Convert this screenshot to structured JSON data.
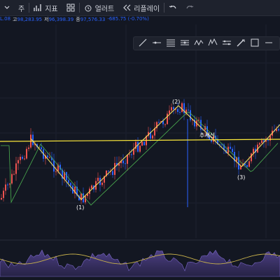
{
  "toolbar": {
    "interval_label": "주",
    "indicators_label": "지표",
    "alert_label": "얼러트",
    "replay_label": "리플레이"
  },
  "legend": {
    "open_value": "L.08",
    "high_label": "고",
    "high_value": "98,283.95",
    "low_label": "저",
    "low_value": "96,398.39",
    "close_label": "종",
    "close_value": "97,576.33",
    "change_value": "-685.75 (-0.70%)"
  },
  "chart_labels": {
    "wave_1": "(1)",
    "wave_2": "(2)",
    "wave_3": "(3)",
    "annotation": "추세선"
  },
  "colors": {
    "background": "#131722",
    "bull_candle": "#ef5350",
    "bear_candle": "#2962ff",
    "trend_line": "#ffeb3b",
    "moving_average": "#4caf50",
    "oscillator_line": "#c9b24b",
    "oscillator_fill": "#5b4a9a"
  },
  "drawing_tools": [
    "trend-line-icon",
    "horizontal-ray-icon",
    "fib-icon",
    "pitchfork-icon",
    "zigzag-icon",
    "wave-icon",
    "ruler-icon",
    "brush-icon",
    "rectangle-icon",
    "more-icon"
  ]
}
